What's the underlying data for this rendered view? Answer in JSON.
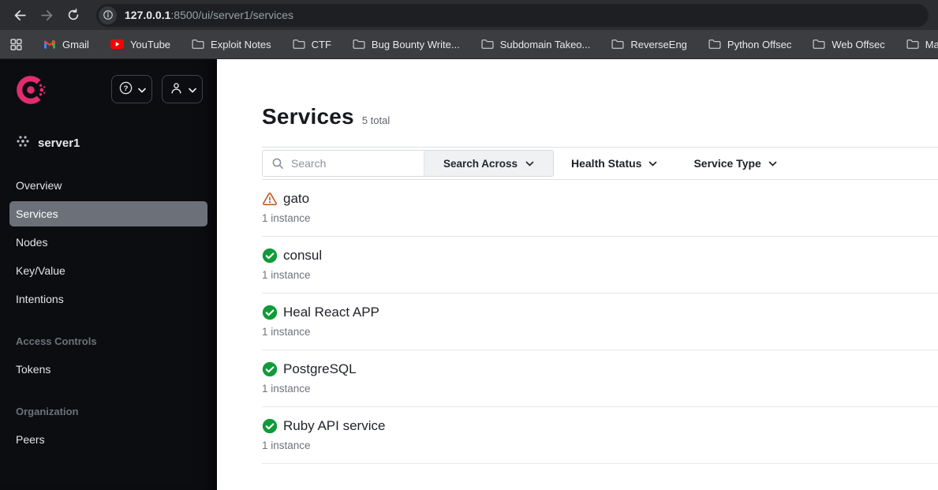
{
  "browser": {
    "url_host": "127.0.0.1",
    "url_path": ":8500/ui/server1/services",
    "bookmarks": [
      {
        "label": "Gmail",
        "icon": "gmail"
      },
      {
        "label": "YouTube",
        "icon": "youtube"
      },
      {
        "label": "Exploit Notes",
        "icon": "folder"
      },
      {
        "label": "CTF",
        "icon": "folder"
      },
      {
        "label": "Bug Bounty Write...",
        "icon": "folder"
      },
      {
        "label": "Subdomain Takeo...",
        "icon": "folder"
      },
      {
        "label": "ReverseEng",
        "icon": "folder"
      },
      {
        "label": "Python Offsec",
        "icon": "folder"
      },
      {
        "label": "Web Offsec",
        "icon": "folder"
      },
      {
        "label": "Malware Research",
        "icon": "folder"
      }
    ]
  },
  "sidebar": {
    "datacenter": "server1",
    "nav": [
      {
        "label": "Overview",
        "state": ""
      },
      {
        "label": "Services",
        "state": "selected"
      },
      {
        "label": "Nodes",
        "state": ""
      },
      {
        "label": "Key/Value",
        "state": ""
      },
      {
        "label": "Intentions",
        "state": ""
      }
    ],
    "access_controls": {
      "title": "Access Controls",
      "item": "Tokens"
    },
    "organization": {
      "title": "Organization",
      "item": "Peers"
    }
  },
  "main": {
    "title": "Services",
    "total": "5 total",
    "search_placeholder": "Search",
    "search_across_label": "Search Across",
    "filters": [
      {
        "label": "Health Status"
      },
      {
        "label": "Service Type"
      }
    ],
    "services": [
      {
        "name": "gato",
        "status": "warning",
        "instances": "1 instance"
      },
      {
        "name": "consul",
        "status": "passing",
        "instances": "1 instance"
      },
      {
        "name": "Heal React APP",
        "status": "passing",
        "instances": "1 instance"
      },
      {
        "name": "PostgreSQL",
        "status": "passing",
        "instances": "1 instance"
      },
      {
        "name": "Ruby API service",
        "status": "passing",
        "instances": "1 instance"
      }
    ]
  },
  "colors": {
    "brand_pink": "#e12d6e",
    "success_green": "#0f9b39",
    "warning_orange": "#c2591d",
    "sidebar_bg": "#0c0d11",
    "selected_nav_bg": "#6b7079",
    "toolbar_bg": "#2b2d30",
    "bookmarks_bg": "#3b3d41"
  },
  "icons": {
    "toolbar": [
      "back-icon",
      "forward-icon",
      "reload-icon",
      "site-info-icon"
    ],
    "bookmarks": [
      "apps-grid-icon",
      "gmail-icon",
      "youtube-icon",
      "folder-icon"
    ],
    "sidebar": [
      "consul-logo-icon",
      "help-icon",
      "user-icon",
      "chevron-down-icon",
      "datacenter-icon"
    ],
    "main": [
      "search-icon",
      "warning-icon",
      "check-circle-icon"
    ]
  }
}
